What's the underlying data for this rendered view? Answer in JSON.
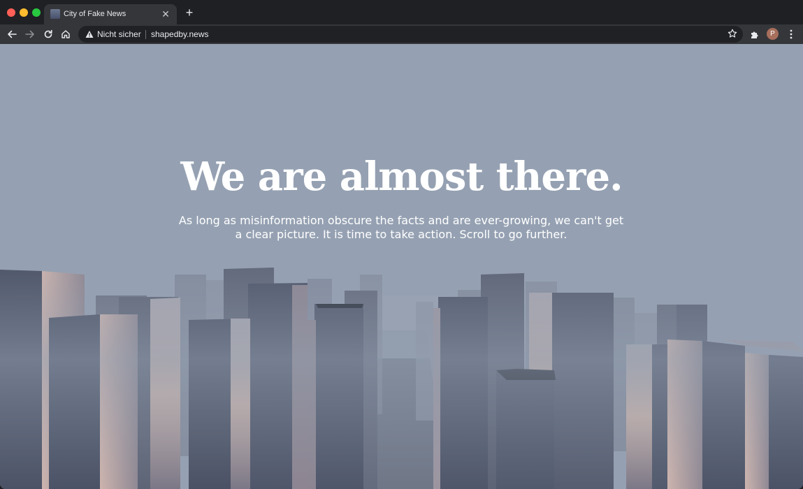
{
  "browser": {
    "tab_title": "City of Fake News",
    "security_label": "Nicht sicher",
    "url": "shapedby.news",
    "profile_initial": "P"
  },
  "hero": {
    "title": "We are almost there.",
    "subtitle": "As long as misinformation obscure the facts and are ever-growing, we can't get a clear picture. It is time to take action. Scroll to go further."
  },
  "icons": {
    "back": "back-arrow-icon",
    "forward": "forward-arrow-icon",
    "reload": "reload-icon",
    "home": "home-icon",
    "warning": "warning-triangle-icon",
    "bookmark": "star-icon",
    "extensions": "puzzle-icon",
    "menu": "kebab-menu-icon",
    "close_tab": "close-icon",
    "new_tab": "plus-icon"
  },
  "colors": {
    "sky": "#95a1b2",
    "building_shadow": "#4d5468",
    "building_lit": "#c6b0aa",
    "chrome_dark": "#1f2023",
    "chrome_toolbar": "#35363a"
  }
}
